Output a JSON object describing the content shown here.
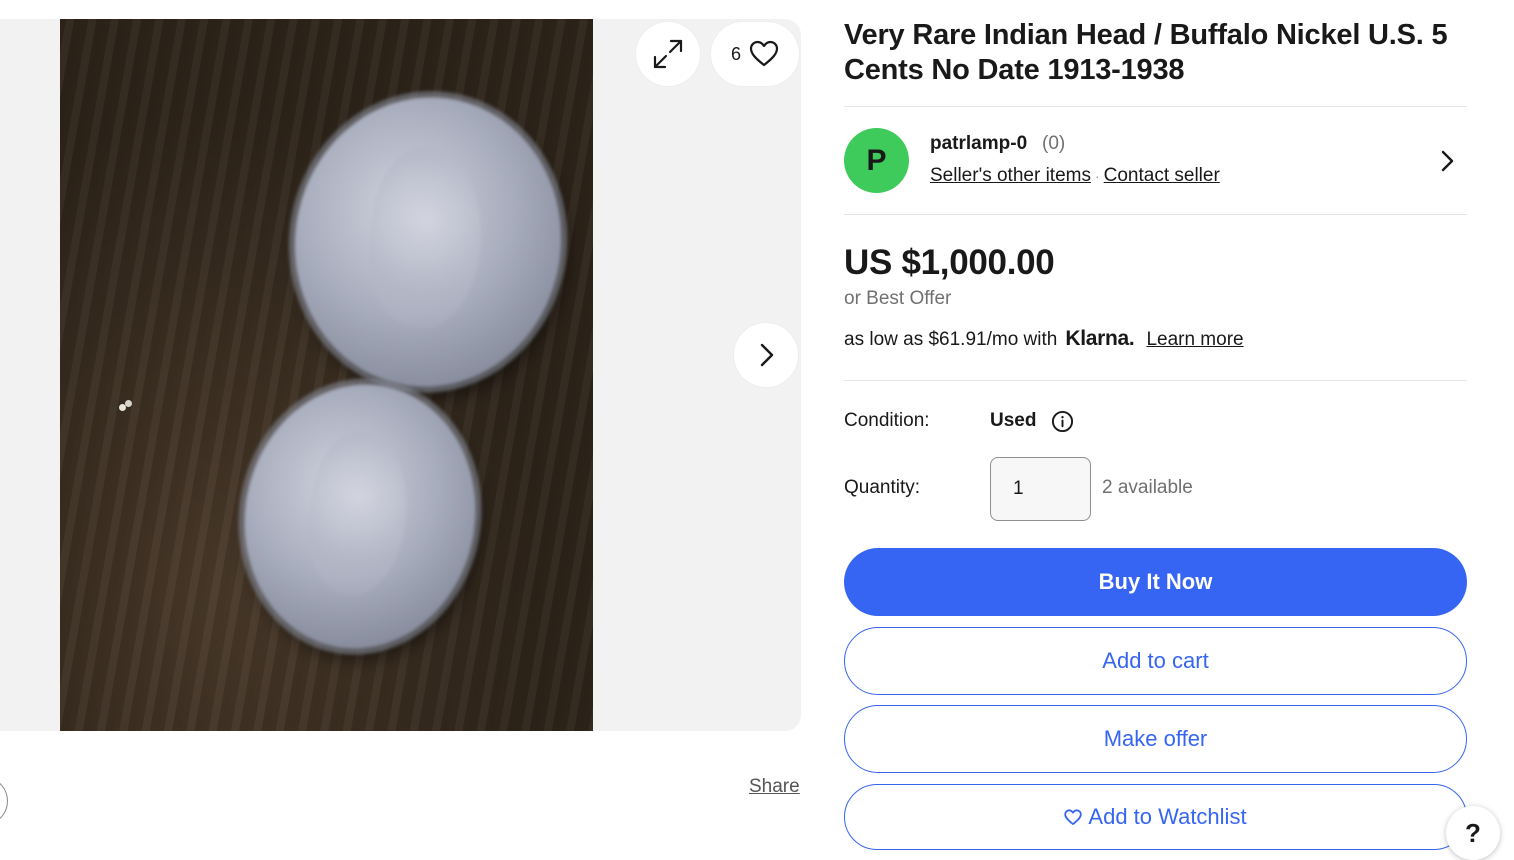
{
  "listing": {
    "title": "Very Rare Indian Head / Buffalo Nickel U.S. 5 Cents No Date 1913-1938"
  },
  "gallery": {
    "watch_count": "6",
    "share_label": "Share",
    "icons": [
      "expand-icon",
      "heart-icon",
      "chevron-right-icon"
    ]
  },
  "seller": {
    "initial": "P",
    "name": "patrlamp-0",
    "feedback": "(0)",
    "other_items_label": "Seller's other items",
    "separator": "·",
    "contact_label": "Contact seller",
    "avatar_color": "#3fca5c"
  },
  "pricing": {
    "price": "US $1,000.00",
    "best_offer": "or Best Offer",
    "klarna_prefix": "as low as $61.91/mo with",
    "klarna_brand": "Klarna.",
    "learn_more": "Learn more"
  },
  "details": {
    "condition_label": "Condition:",
    "condition_value": "Used",
    "quantity_label": "Quantity:",
    "quantity_value": "1",
    "available": "2 available"
  },
  "actions": {
    "buy_now": "Buy It Now",
    "add_to_cart": "Add to cart",
    "make_offer": "Make offer",
    "add_to_watchlist": "Add to Watchlist"
  },
  "help": {
    "label": "?"
  },
  "colors": {
    "accent": "#3665f3",
    "text": "#191919",
    "muted": "#707070",
    "gallery_bg": "#f2f2f2"
  }
}
